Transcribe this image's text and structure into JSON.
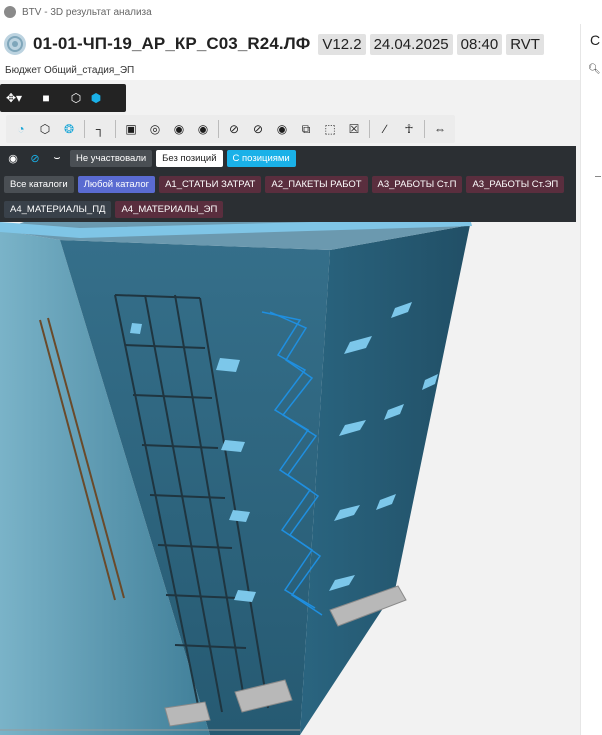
{
  "window": {
    "title": "BTV - 3D результат анализа"
  },
  "header": {
    "model_name": "01-01-ЧП-19_АР_КР_С03_R24.ЛФ",
    "version": "V12.2",
    "date": "24.04.2025",
    "time": "08:40",
    "format": "RVT",
    "subtitle": "Бюджет Общий_стадия_ЭП"
  },
  "right_panel": {
    "letter": "С"
  },
  "filters": {
    "participation": [
      "Не участвовали",
      "Без позиций",
      "С позициями"
    ],
    "catalog_scope": [
      "Все каталоги",
      "Любой каталог"
    ],
    "catalogs": [
      "А1_СТАТЬИ ЗАТРАТ",
      "А2_ПАКЕТЫ РАБОТ",
      "А3_РАБОТЫ Ст.П",
      "А3_РАБОТЫ Ст.ЭП",
      "А4_МАТЕРИАЛЫ_ПД",
      "А4_МАТЕРИАЛЫ_ЭП"
    ]
  },
  "colors": {
    "accent": "#1ab1e8",
    "panel_dark": "#2b2f33",
    "building": "#2f6f8a"
  }
}
